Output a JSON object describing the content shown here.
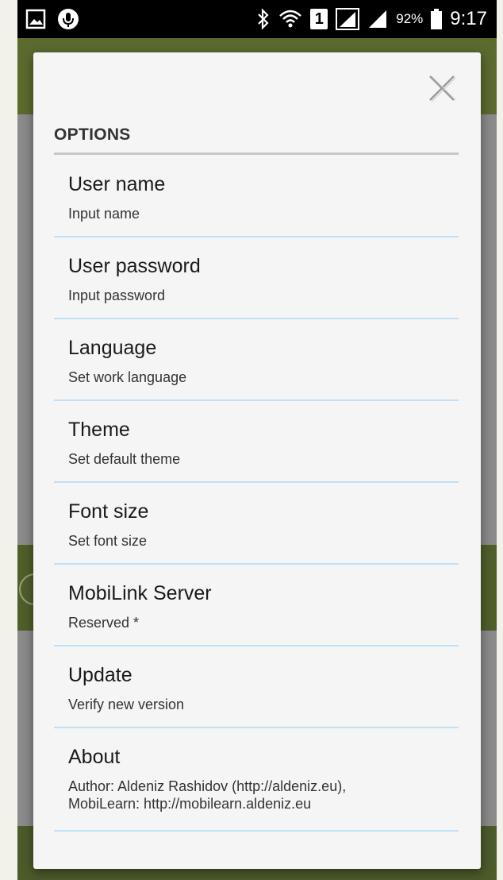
{
  "status_bar": {
    "battery_percent": "92%",
    "time": "9:17",
    "sim_slot": "1",
    "icons": [
      "gallery-icon",
      "voice-icon",
      "bluetooth-icon",
      "wifi-icon",
      "sim-icon",
      "signal-icon",
      "signal-icon-2",
      "battery-icon"
    ]
  },
  "dialog": {
    "title": "OPTIONS",
    "close_icon": "close-icon",
    "items": [
      {
        "label": "User name",
        "desc": "Input name"
      },
      {
        "label": "User password",
        "desc": "Input password"
      },
      {
        "label": "Language",
        "desc": "Set work language"
      },
      {
        "label": "Theme",
        "desc": "Set default theme"
      },
      {
        "label": "Font size",
        "desc": "Set font size"
      },
      {
        "label": "MobiLink Server",
        "desc": "Reserved *"
      },
      {
        "label": "Update",
        "desc": "Verify new version"
      },
      {
        "label": "About",
        "desc_line1": "Author: Aldeniz Rashidov (http://aldeniz.eu),",
        "desc_line2": "MobiLearn: http://mobilearn.aldeniz.eu"
      }
    ]
  },
  "colors": {
    "app_green": "#5b6b2e",
    "divider_blue": "#bfe0f6",
    "dialog_bg": "#f5f5f5"
  }
}
